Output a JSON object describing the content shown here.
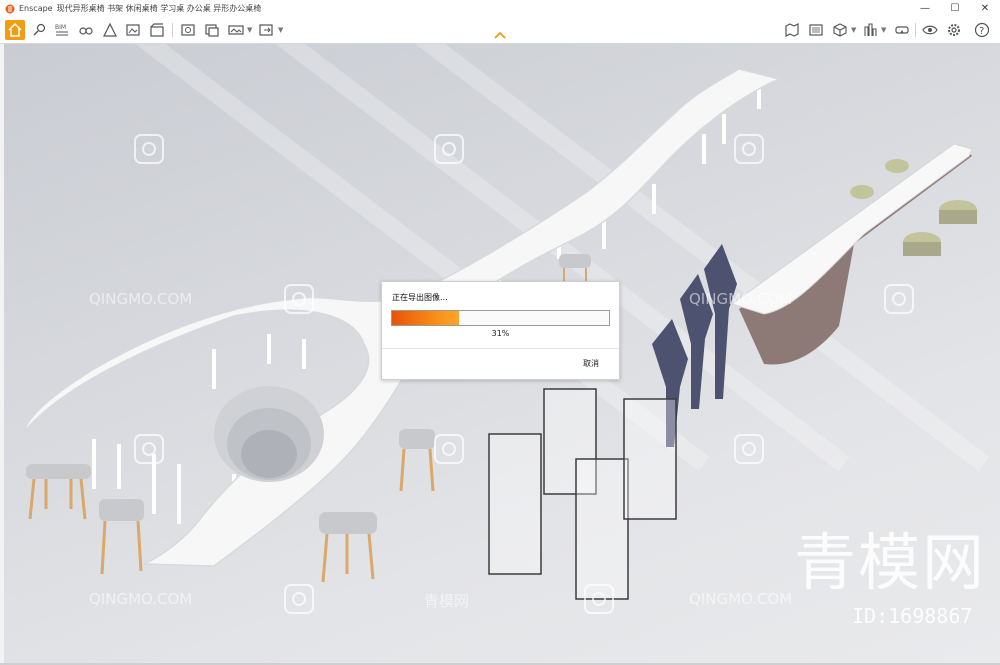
{
  "window": {
    "app_name": "Enscape",
    "title": "现代异形桌椅 书架 休闲桌椅 学习桌 办公桌 异形办公桌椅",
    "controls": {
      "minimize": "—",
      "maximize": "☐",
      "close": "✕"
    }
  },
  "toolbar": {
    "left_icons": [
      "home-icon",
      "live-link-icon",
      "bim-icon",
      "views-icon",
      "assets-icon",
      "atmosphere-icon",
      "sun-icon",
      "video-icon"
    ],
    "export_icons": [
      "screenshot-icon",
      "batch-render-icon",
      "panorama-icon",
      "export-icon"
    ],
    "right_icons": [
      "map-icon",
      "gallery-icon",
      "cube-icon",
      "site-context-icon",
      "vr-icon",
      "visual-settings-icon",
      "settings-icon",
      "help-icon"
    ],
    "bim_label": "BIM",
    "help_label": "?"
  },
  "watermarks": {
    "small": "QINGMO.COM",
    "small_cn": "青模网",
    "big": "青模网",
    "id": "ID:1698867"
  },
  "dialog": {
    "title": "正在导出图像...",
    "progress_percent": 31,
    "progress_text": "31%",
    "cancel_label": "取消"
  },
  "colors": {
    "accent": "#f39c12",
    "progress_start": "#e8520c",
    "progress_end": "#ffa52a"
  }
}
